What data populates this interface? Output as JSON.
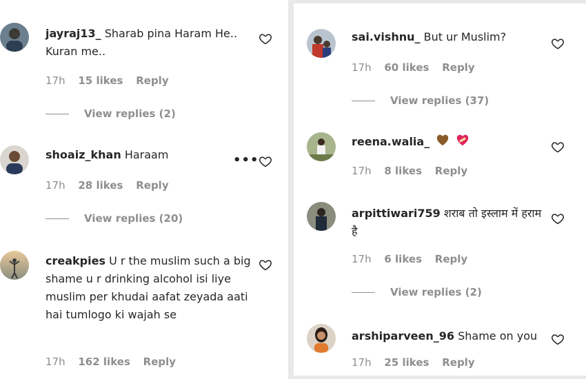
{
  "left": {
    "comments": [
      {
        "username": "jayraj13_",
        "text": "Sharab pina Haram He.. Kuran me..",
        "time": "17h",
        "likes": "15 likes",
        "reply": "Reply",
        "view_replies": "View replies (2)"
      },
      {
        "username": "shoaiz_khan",
        "text": "Haraam",
        "time": "17h",
        "likes": "28 likes",
        "reply": "Reply",
        "view_replies": "View replies (20)"
      },
      {
        "username": "creakpies",
        "text": "U r the muslim such a big shame u r drinking alcohol isi liye muslim per khudai aafat zeyada aati hai tumlogo ki wajah se",
        "time": "17h",
        "likes": "162 likes",
        "reply": "Reply"
      }
    ]
  },
  "right": {
    "comments": [
      {
        "username": "sai.vishnu_",
        "text": "But ur Muslim?",
        "time": "17h",
        "likes": "60 likes",
        "reply": "Reply",
        "view_replies": "View replies (37)"
      },
      {
        "username": "reena.walia_",
        "text": "",
        "time": "17h",
        "likes": "8 likes",
        "reply": "Reply"
      },
      {
        "username": "arpittiwari759",
        "text": "शराब तो इस्लाम में हराम है",
        "time": "17h",
        "likes": "6 likes",
        "reply": "Reply",
        "view_replies": "View replies (2)"
      },
      {
        "username": "arshiparveen_96",
        "text": "Shame on you",
        "time": "17h",
        "likes": "25 likes",
        "reply": "Reply"
      }
    ]
  },
  "colors": {
    "text": "#262626",
    "muted": "#8e8e8e",
    "background": "#ffffff",
    "heart_brown": "#8b5a2b",
    "heart_red": "#e0245e"
  },
  "icons": {
    "like": "heart-outline-icon",
    "more": "more-dots-icon"
  }
}
